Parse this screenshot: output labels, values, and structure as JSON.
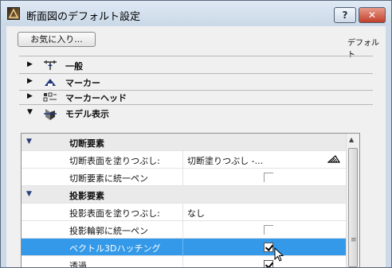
{
  "window": {
    "title": "断面図のデフォルト設定",
    "help_label": "?",
    "close_label": "✕"
  },
  "toolbar": {
    "favorites_label": "お気に入り...",
    "default_label": "デフォルト"
  },
  "sections": [
    {
      "label": "一般",
      "expanded": false,
      "icon": "general-settings-icon"
    },
    {
      "label": "マーカー",
      "expanded": false,
      "icon": "marker-icon"
    },
    {
      "label": "マーカーヘッド",
      "expanded": false,
      "icon": "marker-head-icon"
    },
    {
      "label": "モデル表示",
      "expanded": true,
      "icon": "model-display-icon"
    }
  ],
  "panel": {
    "groups": [
      {
        "label": "切断要素"
      },
      {
        "label": "投影要素"
      }
    ],
    "rows": [
      {
        "label": "切断表面を塗りつぶし:",
        "value": "切断塗りつぶし -..."
      },
      {
        "label": "切断要素に統一ペン",
        "value": ""
      },
      {
        "label": "投影表面を塗りつぶし:",
        "value": "なし"
      },
      {
        "label": "投影輪郭に統一ペン",
        "value": ""
      },
      {
        "label": "ベクトル3Dハッチング",
        "value": ""
      },
      {
        "label": "透過",
        "value": ""
      }
    ]
  },
  "colors": {
    "selection": "#3399e8",
    "titlebar": "#cbd9e8",
    "close_button": "#c2402a"
  }
}
